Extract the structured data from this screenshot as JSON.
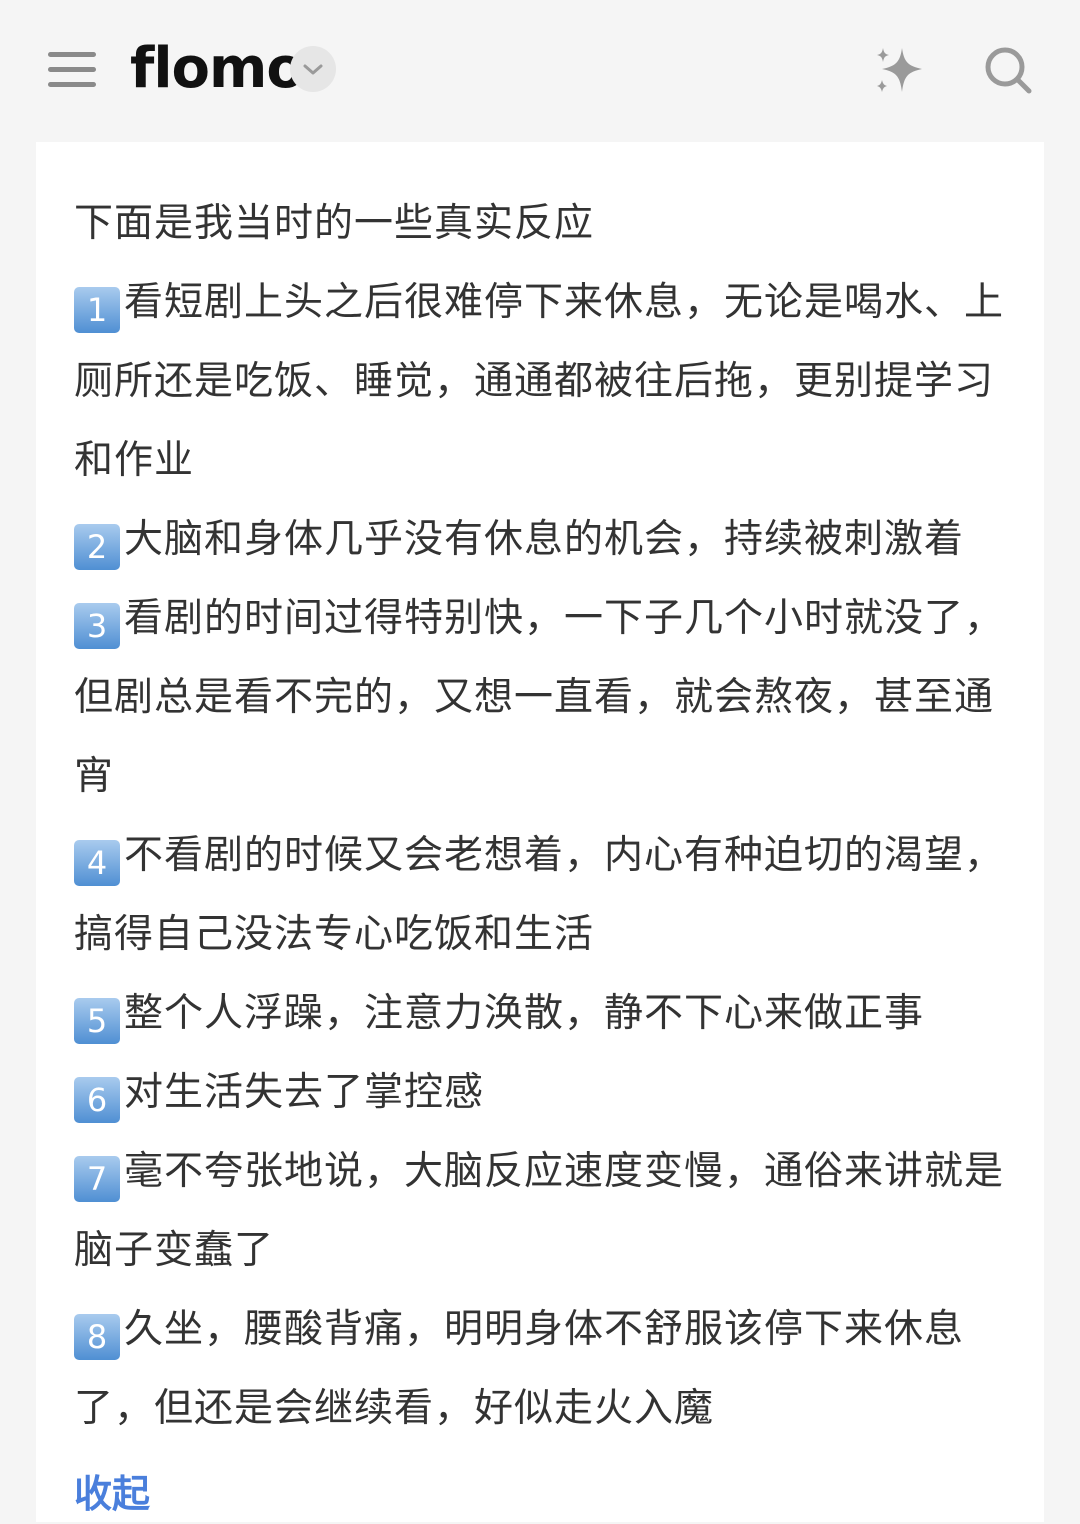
{
  "header": {
    "brand": "flomo",
    "icons": {
      "menu": "menu-icon",
      "dropdown": "chevron-down-icon",
      "ai": "sparkle-icon",
      "search": "search-icon"
    }
  },
  "memo": {
    "intro": "下面是我当时的一些真实反应",
    "items": [
      {
        "badge": "1",
        "text": "看短剧上头之后很难停下来休息，无论是喝水、上厕所还是吃饭、睡觉，通通都被往后拖，更别提学习和作业"
      },
      {
        "badge": "2",
        "text": "大脑和身体几乎没有休息的机会，持续被刺激着"
      },
      {
        "badge": "3",
        "text": "看剧的时间过得特别快，一下子几个小时就没了，但剧总是看不完的，又想一直看，就会熬夜，甚至通宵"
      },
      {
        "badge": "4",
        "text": "不看剧的时候又会老想着，内心有种迫切的渴望，搞得自己没法专心吃饭和生活"
      },
      {
        "badge": "5",
        "text": "整个人浮躁，注意力涣散，静不下心来做正事"
      },
      {
        "badge": "6",
        "text": "对生活失去了掌控感"
      },
      {
        "badge": "7",
        "text": "毫不夸张地说，大脑反应速度变慢，通俗来讲就是脑子变蠢了"
      },
      {
        "badge": "8",
        "text": "久坐，腰酸背痛，明明身体不舒服该停下来休息了，但还是会继续看，好似走火入魔"
      }
    ],
    "collapse_label": "收起"
  },
  "colors": {
    "background": "#f5f5f5",
    "card": "#ffffff",
    "text": "#333333",
    "link": "#4a7fdc",
    "badge": "#4f8fd3"
  }
}
